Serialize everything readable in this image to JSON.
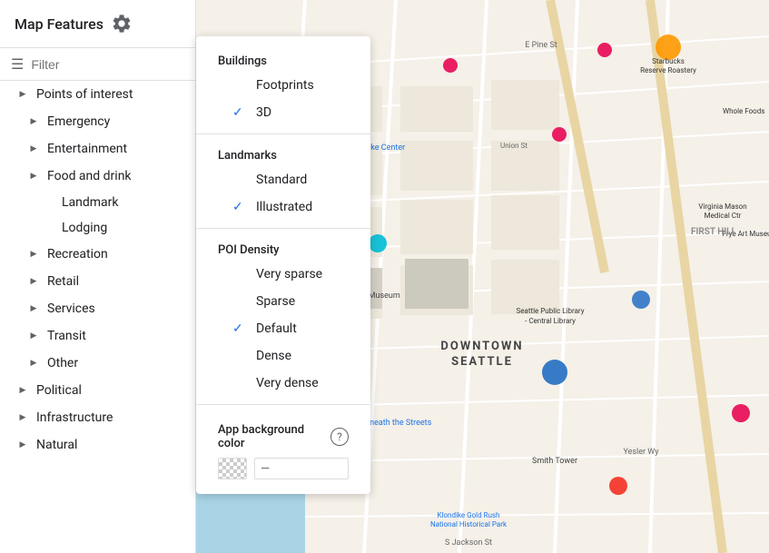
{
  "sidebar": {
    "title": "Map Features",
    "filter_placeholder": "Filter",
    "items": [
      {
        "id": "points-of-interest",
        "label": "Points of interest",
        "level": 0,
        "has_arrow": true,
        "expanded": true
      },
      {
        "id": "emergency",
        "label": "Emergency",
        "level": 1,
        "has_arrow": true
      },
      {
        "id": "entertainment",
        "label": "Entertainment",
        "level": 1,
        "has_arrow": true
      },
      {
        "id": "food-and-drink",
        "label": "Food and drink",
        "level": 1,
        "has_arrow": true
      },
      {
        "id": "landmark",
        "label": "Landmark",
        "level": 2
      },
      {
        "id": "lodging",
        "label": "Lodging",
        "level": 2
      },
      {
        "id": "recreation",
        "label": "Recreation",
        "level": 1,
        "has_arrow": true
      },
      {
        "id": "retail",
        "label": "Retail",
        "level": 1,
        "has_arrow": true
      },
      {
        "id": "services",
        "label": "Services",
        "level": 1,
        "has_arrow": true
      },
      {
        "id": "transit",
        "label": "Transit",
        "level": 1,
        "has_arrow": true
      },
      {
        "id": "other",
        "label": "Other",
        "level": 1,
        "has_arrow": true
      },
      {
        "id": "political",
        "label": "Political",
        "level": 0,
        "has_arrow": true
      },
      {
        "id": "infrastructure",
        "label": "Infrastructure",
        "level": 0,
        "has_arrow": true
      },
      {
        "id": "natural",
        "label": "Natural",
        "level": 0,
        "has_arrow": true
      }
    ]
  },
  "dropdown": {
    "buildings_section": "Buildings",
    "footprints_label": "Footprints",
    "three_d_label": "3D",
    "three_d_checked": true,
    "landmarks_section": "Landmarks",
    "standard_label": "Standard",
    "illustrated_label": "Illustrated",
    "illustrated_checked": true,
    "poi_density_section": "POI Density",
    "density_options": [
      {
        "id": "very-sparse",
        "label": "Very sparse",
        "checked": false
      },
      {
        "id": "sparse",
        "label": "Sparse",
        "checked": false
      },
      {
        "id": "default",
        "label": "Default",
        "checked": true
      },
      {
        "id": "dense",
        "label": "Dense",
        "checked": false
      },
      {
        "id": "very-dense",
        "label": "Very dense",
        "checked": false
      }
    ],
    "bg_color_label": "App background color",
    "bg_color_value": "—"
  }
}
